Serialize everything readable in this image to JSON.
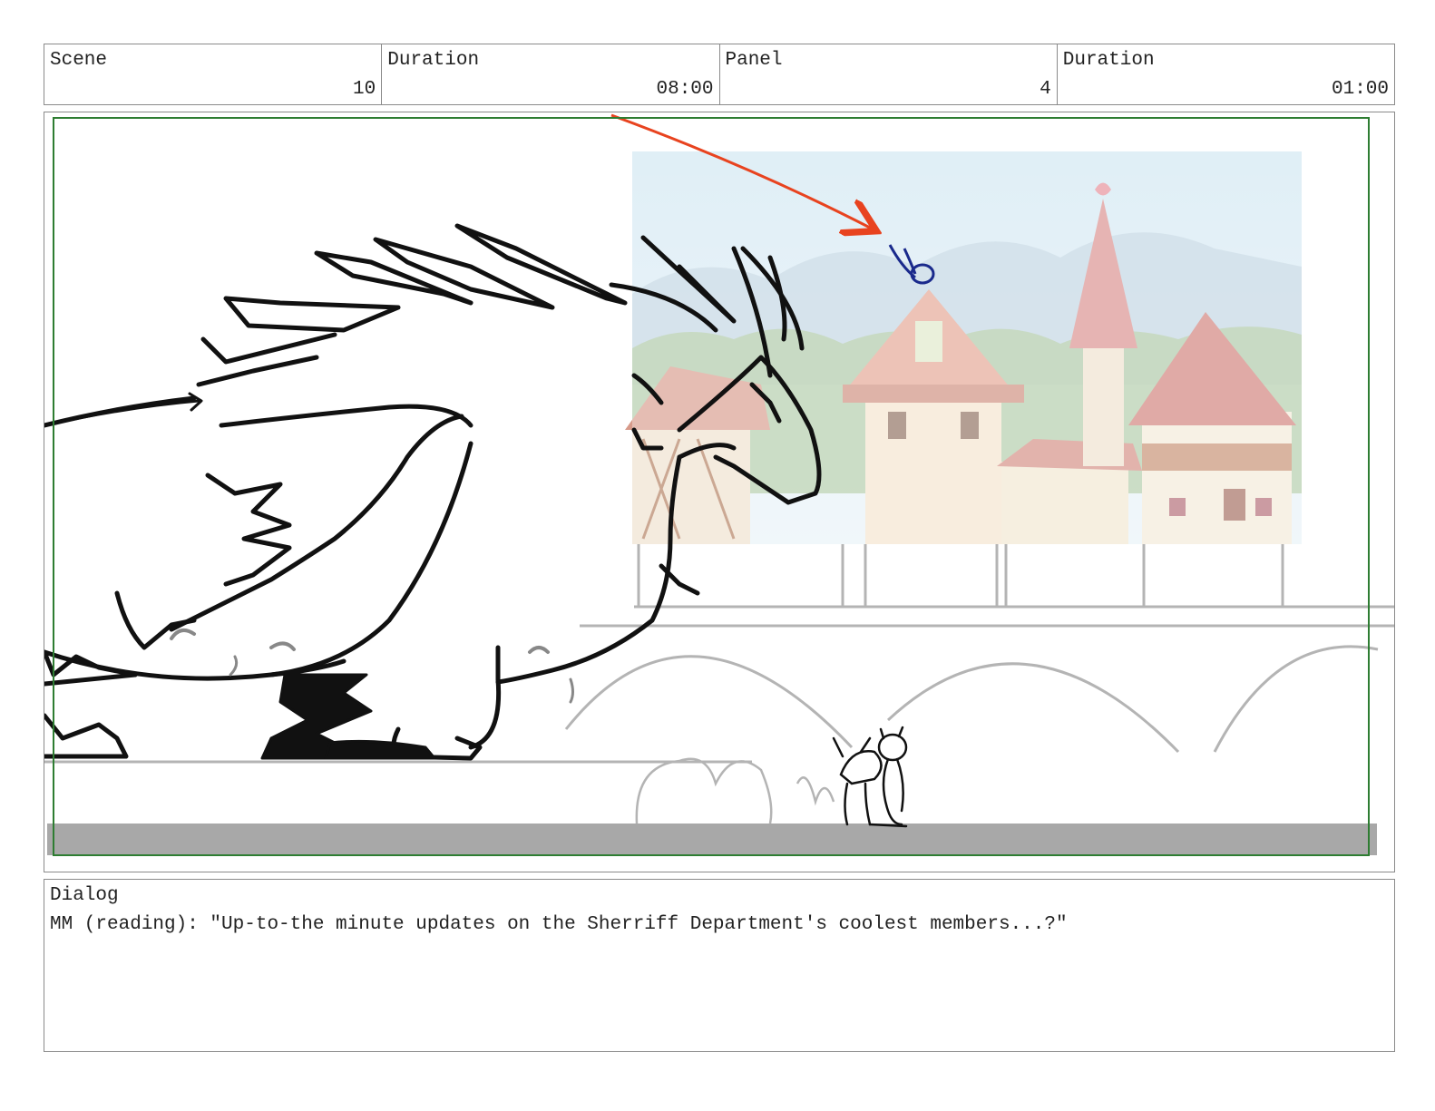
{
  "header": {
    "scene_label": "Scene",
    "scene_value": "10",
    "scene_duration_label": "Duration",
    "scene_duration_value": "08:00",
    "panel_label": "Panel",
    "panel_value": "4",
    "panel_duration_label": "Duration",
    "panel_duration_value": "01:00"
  },
  "colors": {
    "safe_frame": "#2e7d32",
    "motion_arrow": "#e8431f",
    "character_mark": "#1a2a8c",
    "ground_bar": "#a8a8a8",
    "sketch_line": "#111111",
    "bridge_line": "#b4b4b4"
  },
  "icons": {
    "motion_arrow": "arrow-icon"
  },
  "dialog": {
    "label": "Dialog",
    "text": "MM (reading): \"Up-to-the minute updates on the Sherriff Department's coolest members...?\""
  }
}
